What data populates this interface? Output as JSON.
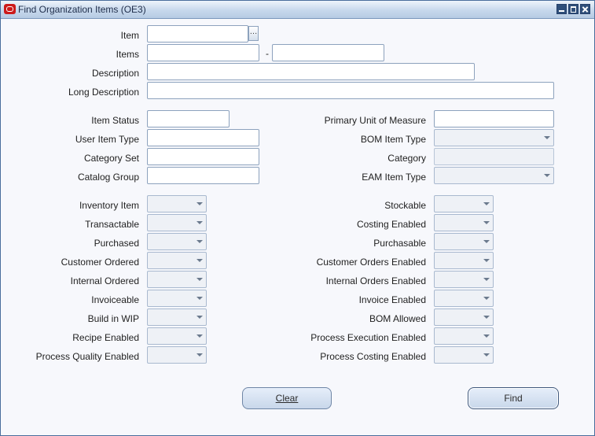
{
  "window": {
    "title": "Find Organization Items (OE3)"
  },
  "fields": {
    "item": {
      "label": "Item",
      "value": ""
    },
    "items": {
      "label": "Items",
      "from": "",
      "to": "",
      "separator": "-"
    },
    "description": {
      "label": "Description",
      "value": ""
    },
    "long_description": {
      "label": "Long Description",
      "value": ""
    },
    "item_status": {
      "label": "Item Status",
      "value": ""
    },
    "user_item_type": {
      "label": "User Item Type",
      "value": ""
    },
    "category_set": {
      "label": "Category Set",
      "value": ""
    },
    "catalog_group": {
      "label": "Catalog Group",
      "value": ""
    },
    "primary_uom": {
      "label": "Primary Unit of Measure",
      "value": ""
    },
    "bom_item_type": {
      "label": "BOM Item Type",
      "value": ""
    },
    "category": {
      "label": "Category",
      "value": ""
    },
    "eam_item_type": {
      "label": "EAM Item Type",
      "value": ""
    }
  },
  "flags_left": [
    {
      "label": "Inventory Item",
      "value": ""
    },
    {
      "label": "Transactable",
      "value": ""
    },
    {
      "label": "Purchased",
      "value": ""
    },
    {
      "label": "Customer Ordered",
      "value": ""
    },
    {
      "label": "Internal Ordered",
      "value": ""
    },
    {
      "label": "Invoiceable",
      "value": ""
    },
    {
      "label": "Build in WIP",
      "value": ""
    },
    {
      "label": "Recipe Enabled",
      "value": ""
    },
    {
      "label": "Process Quality Enabled",
      "value": ""
    }
  ],
  "flags_right": [
    {
      "label": "Stockable",
      "value": ""
    },
    {
      "label": "Costing Enabled",
      "value": ""
    },
    {
      "label": "Purchasable",
      "value": ""
    },
    {
      "label": "Customer Orders Enabled",
      "value": ""
    },
    {
      "label": "Internal Orders Enabled",
      "value": ""
    },
    {
      "label": "Invoice Enabled",
      "value": ""
    },
    {
      "label": "BOM Allowed",
      "value": ""
    },
    {
      "label": "Process Execution Enabled",
      "value": ""
    },
    {
      "label": "Process Costing Enabled",
      "value": ""
    }
  ],
  "buttons": {
    "clear": "Clear",
    "find": "Find"
  },
  "icons": {
    "lov": "…"
  },
  "colors": {
    "titlebar": "#c7d8ec",
    "window_border": "#4a6e9c",
    "app_icon": "#cc1b1b"
  }
}
